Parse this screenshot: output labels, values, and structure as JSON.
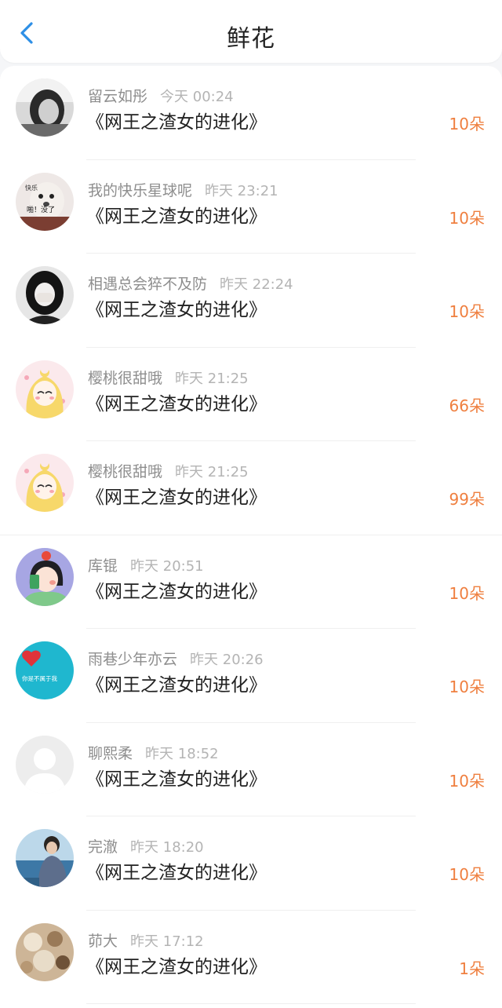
{
  "header": {
    "title": "鲜花"
  },
  "theme": {
    "accent": "#2e8fe6",
    "count_color": "#ef7f3f",
    "name_color": "#8e8e8e",
    "time_color": "#b4b4b4"
  },
  "items": [
    {
      "name": "留云如彤",
      "time": "今天 00:24",
      "book": "《网王之渣女的进化》",
      "count": "10朵",
      "avatar": "girl-photo-dark"
    },
    {
      "name": "我的快乐星球呢",
      "time": "昨天 23:21",
      "book": "《网王之渣女的进化》",
      "count": "10朵",
      "avatar": "dog-meme",
      "avatar_text": [
        "快乐",
        "啪！没了"
      ]
    },
    {
      "name": "相遇总会猝不及防",
      "time": "昨天 22:24",
      "book": "《网王之渣女的进化》",
      "count": "10朵",
      "avatar": "girl-covering-face"
    },
    {
      "name": "樱桃很甜哦",
      "time": "昨天 21:25",
      "book": "《网王之渣女的进化》",
      "count": "66朵",
      "avatar": "sailor-moon"
    },
    {
      "name": "樱桃很甜哦",
      "time": "昨天 21:25",
      "book": "《网王之渣女的进化》",
      "count": "99朵",
      "avatar": "sailor-moon"
    },
    {
      "name": "库锟",
      "time": "昨天 20:51",
      "book": "《网王之渣女的进化》",
      "count": "10朵",
      "avatar": "cartoon-girl-apple"
    },
    {
      "name": "雨巷少年亦云",
      "time": "昨天 20:26",
      "book": "《网王之渣女的进化》",
      "count": "10朵",
      "avatar": "cyan-heart",
      "avatar_text": [
        "你是不属于我"
      ]
    },
    {
      "name": "聊熙柔",
      "time": "昨天 18:52",
      "book": "《网王之渣女的进化》",
      "count": "10朵",
      "avatar": "default-user"
    },
    {
      "name": "完澈",
      "time": "昨天 18:20",
      "book": "《网王之渣女的进化》",
      "count": "10朵",
      "avatar": "boy-sea-photo"
    },
    {
      "name": "茆大",
      "time": "昨天 17:12",
      "book": "《网王之渣女的进化》",
      "count": "1朵",
      "avatar": "seashells-photo"
    }
  ]
}
